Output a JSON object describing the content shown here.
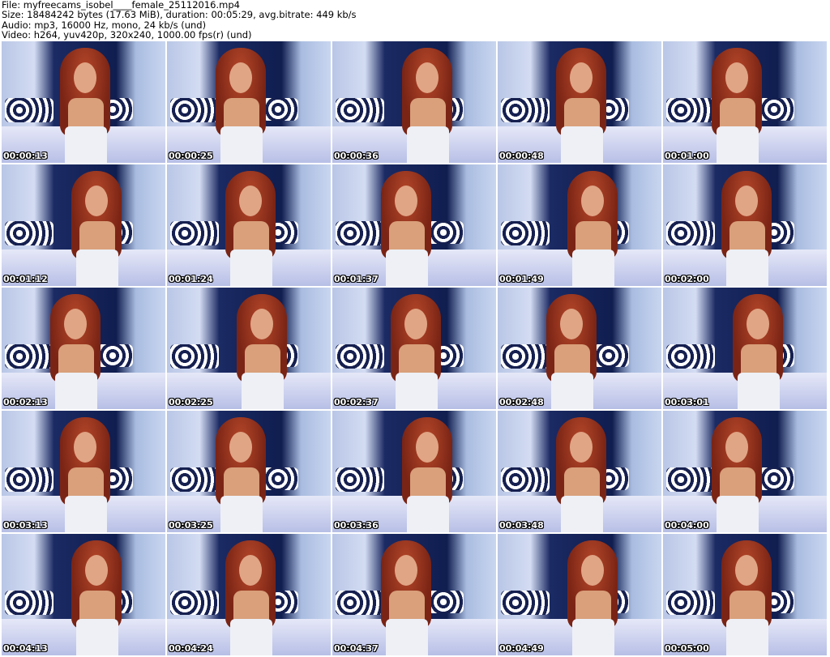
{
  "info": {
    "file": "File: myfreecams_isobel____female_25112016.mp4",
    "size": "Size: 18484242 bytes (17.63 MiB), duration: 00:05:29, avg.bitrate: 449 kb/s",
    "audio": "Audio: mp3, 16000 Hz, mono, 24 kb/s (und)",
    "video": "Video: h264, yuv420p, 320x240, 1000.00 fps(r) (und)"
  },
  "thumbnails": [
    "00:00:13",
    "00:00:25",
    "00:00:36",
    "00:00:48",
    "00:01:00",
    "00:01:12",
    "00:01:24",
    "00:01:37",
    "00:01:49",
    "00:02:00",
    "00:02:13",
    "00:02:25",
    "00:02:37",
    "00:02:48",
    "00:03:01",
    "00:03:13",
    "00:03:25",
    "00:03:36",
    "00:03:48",
    "00:04:00",
    "00:04:13",
    "00:04:24",
    "00:04:37",
    "00:04:49",
    "00:05:00"
  ]
}
